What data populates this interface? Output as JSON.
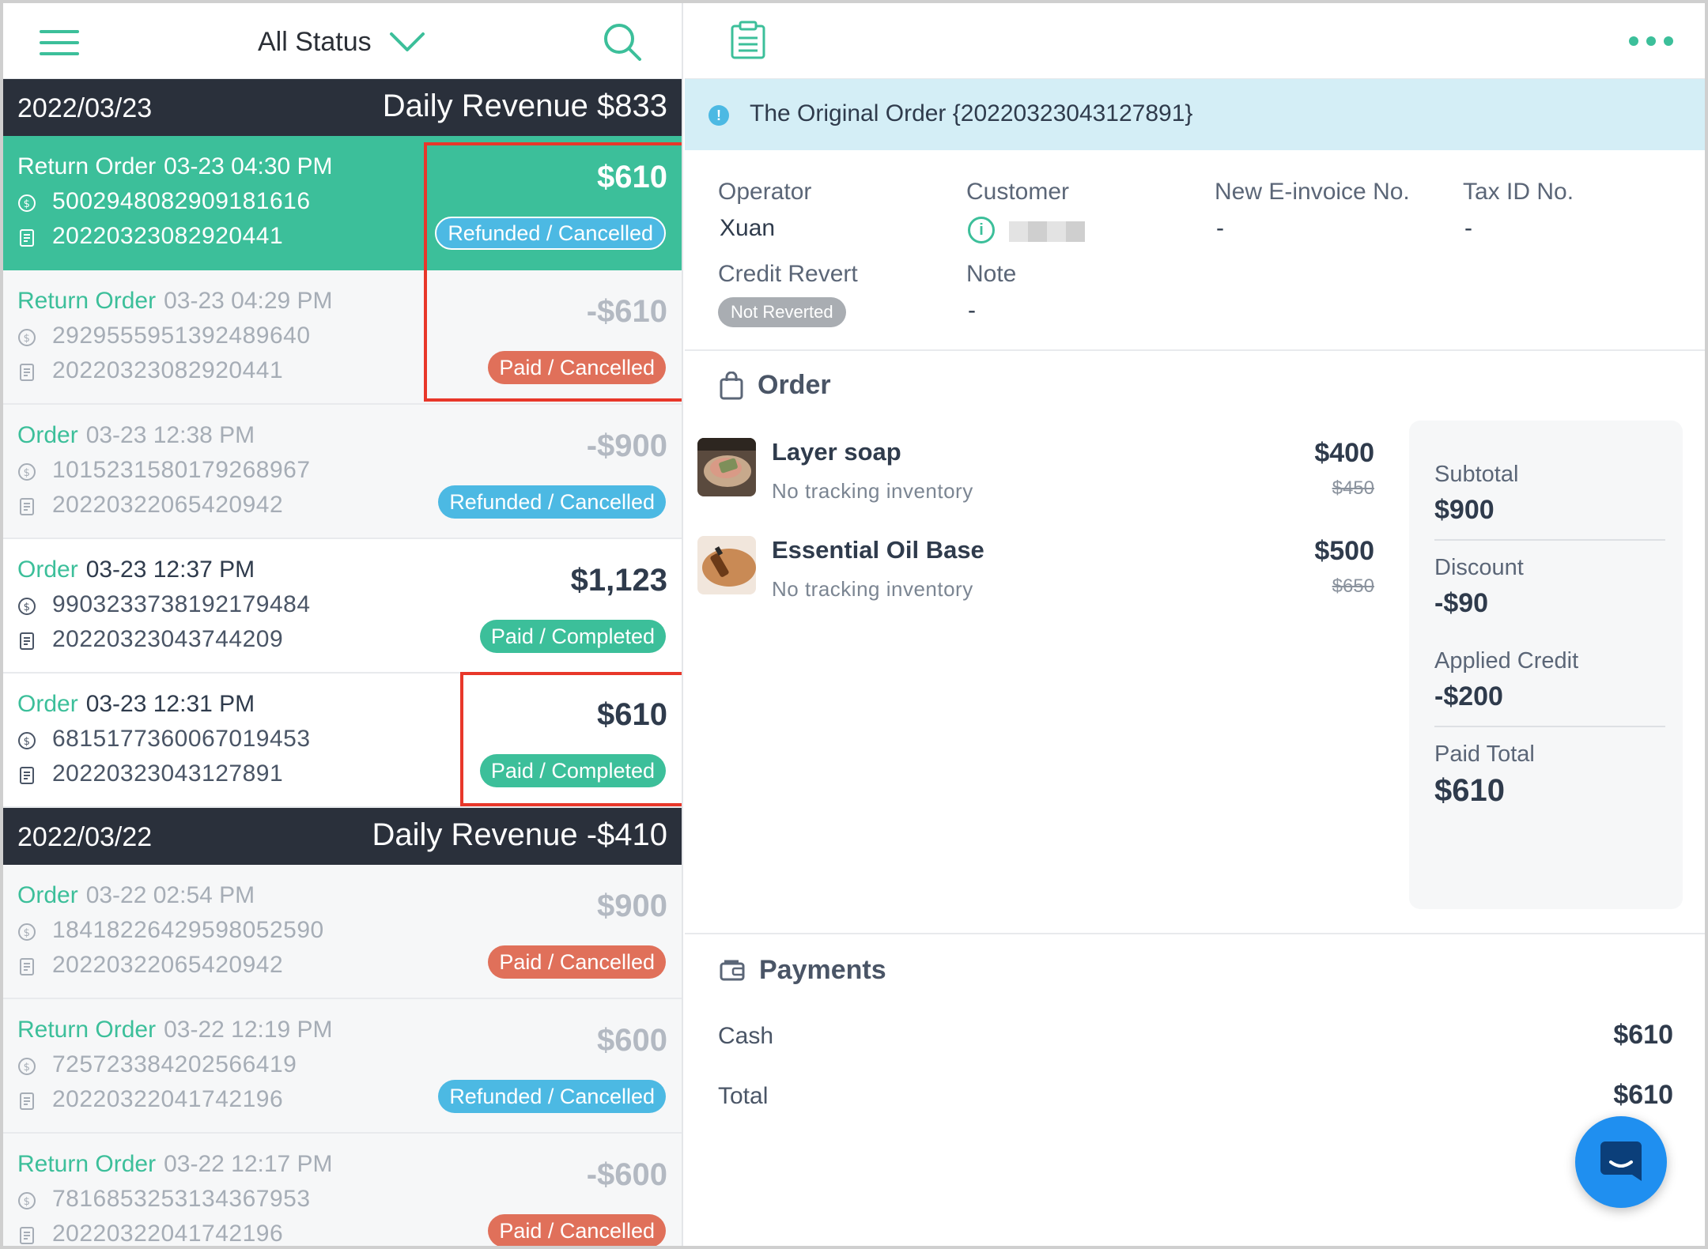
{
  "left_pane": {
    "filter_label": "All Status",
    "days": [
      {
        "date": "2022/03/23",
        "revenue": "Daily Revenue $833",
        "orders": [
          {
            "type": "Return Order",
            "time": "03-23 04:30 PM",
            "payment_no": "500294808290918​1616",
            "order_no": "20220323082920441",
            "amount": "$610",
            "status": "Refunded / Cancelled",
            "status_kind": "refunded",
            "selected": true,
            "dim": false
          },
          {
            "type": "Return Order",
            "time": "03-23 04:29 PM",
            "payment_no": "2929555951392489640",
            "order_no": "20220323082920441",
            "amount": "-$610",
            "status": "Paid / Cancelled",
            "status_kind": "paid-cancelled",
            "selected": false,
            "dim": true
          },
          {
            "type": "Order",
            "time": "03-23 12:38 PM",
            "payment_no": "1015231580179268967",
            "order_no": "20220322065420942",
            "amount": "-$900",
            "status": "Refunded / Cancelled",
            "status_kind": "refunded",
            "selected": false,
            "dim": true
          },
          {
            "type": "Order",
            "time": "03-23 12:37 PM",
            "payment_no": "9903233738192179484",
            "order_no": "20220323043744209",
            "amount": "$1,123",
            "status": "Paid / Completed",
            "status_kind": "paid-completed",
            "selected": false,
            "dim": false
          },
          {
            "type": "Order",
            "time": "03-23 12:31 PM",
            "payment_no": "6815177360067019453",
            "order_no": "20220323043127891",
            "amount": "$610",
            "status": "Paid / Completed",
            "status_kind": "paid-completed",
            "selected": false,
            "dim": false
          }
        ]
      },
      {
        "date": "2022/03/22",
        "revenue": "Daily Revenue -$410",
        "orders": [
          {
            "type": "Order",
            "time": "03-22 02:54 PM",
            "payment_no": "1841822642959805259​0",
            "order_no": "20220322065420942",
            "amount": "$900",
            "status": "Paid / Cancelled",
            "status_kind": "paid-cancelled",
            "selected": false,
            "dim": true
          },
          {
            "type": "Return Order",
            "time": "03-22 12:19 PM",
            "payment_no": "725723384202566419",
            "order_no": "20220322041742196",
            "amount": "$600",
            "status": "Refunded / Cancelled",
            "status_kind": "refunded",
            "selected": false,
            "dim": true
          },
          {
            "type": "Return Order",
            "time": "03-22 12:17 PM",
            "payment_no": "7816853253134367953",
            "order_no": "20220322041742196",
            "amount": "-$600",
            "status": "Paid / Cancelled",
            "status_kind": "paid-cancelled",
            "selected": false,
            "dim": true
          }
        ]
      }
    ]
  },
  "right_pane": {
    "banner": "The Original Order {20220323043127891}",
    "fields": {
      "operator_label": "Operator",
      "operator_value": "Xuan",
      "customer_label": "Customer",
      "einvoice_label": "New E-invoice No.",
      "einvoice_value": "-",
      "taxid_label": "Tax ID No.",
      "taxid_value": "-",
      "credit_label": "Credit Revert",
      "credit_value": "Not Reverted",
      "note_label": "Note",
      "note_value": "-"
    },
    "order_title": "Order",
    "items": [
      {
        "name": "Layer soap",
        "sub": "No tracking inventory",
        "price": "$400",
        "original": "$450"
      },
      {
        "name": "Essential Oil Base",
        "sub": "No tracking inventory",
        "price": "$500",
        "original": "$650"
      }
    ],
    "summary": {
      "subtotal_label": "Subtotal",
      "subtotal_value": "$900",
      "discount_label": "Discount",
      "discount_value": "-$90",
      "credit_label": "Applied Credit",
      "credit_value": "-$200",
      "paid_label": "Paid Total",
      "paid_value": "$610"
    },
    "payments_title": "Payments",
    "payments": {
      "cash_label": "Cash",
      "cash_value": "$610",
      "total_label": "Total",
      "total_value": "$610"
    }
  },
  "colors": {
    "accent": "#3cbf9a",
    "refunded": "#4cb9e3",
    "paid_cancelled": "#e0705a",
    "dark_header": "#2a303b",
    "highlight": "#e8372a"
  }
}
